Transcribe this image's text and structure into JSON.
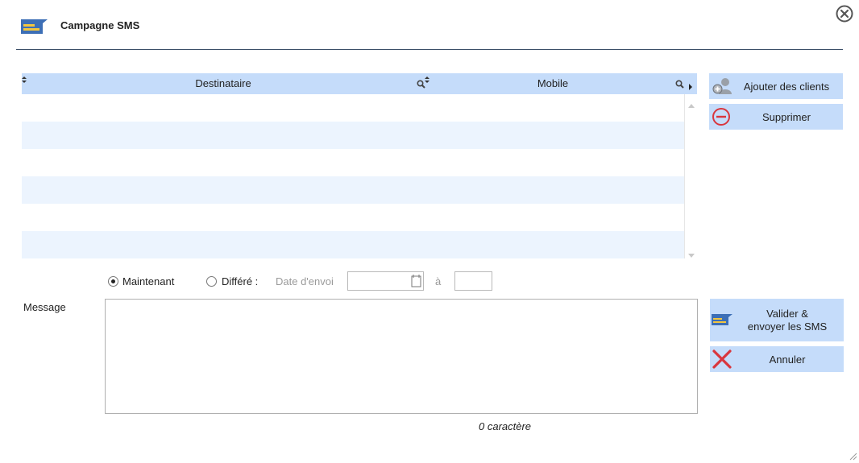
{
  "dialog": {
    "title": "Campagne SMS",
    "close_icon": "close-circle-icon"
  },
  "grid": {
    "columns": [
      {
        "label": "Destinataire",
        "icon": "search-icon"
      },
      {
        "label": "Mobile",
        "icon": "search-icon"
      }
    ],
    "rows": []
  },
  "actions": {
    "add_clients": {
      "label": "Ajouter des clients",
      "icon": "add-user-icon"
    },
    "delete": {
      "label": "Supprimer",
      "icon": "minus-circle-icon"
    }
  },
  "schedule": {
    "now_label": "Maintenant",
    "deferred_label": "Différé :",
    "date_label": "Date d'envoi",
    "at_label": "à",
    "date_value": "",
    "time_value": "",
    "selected": "Maintenant"
  },
  "message": {
    "label": "Message",
    "value": "",
    "counter": "0 caractère"
  },
  "footer_actions": {
    "validate": {
      "label_line1": "Valider &",
      "label_line2": "envoyer les SMS",
      "icon": "sms-icon"
    },
    "cancel": {
      "label": "Annuler",
      "icon": "cancel-x-icon"
    }
  },
  "colors": {
    "header_blue": "#c5dcfa",
    "row_alt": "#ecf4fe",
    "rule": "#3b4f68",
    "sms_yellow": "#f3c63f",
    "sms_blue": "#3d6fb6",
    "delete_red": "#d9363e"
  }
}
